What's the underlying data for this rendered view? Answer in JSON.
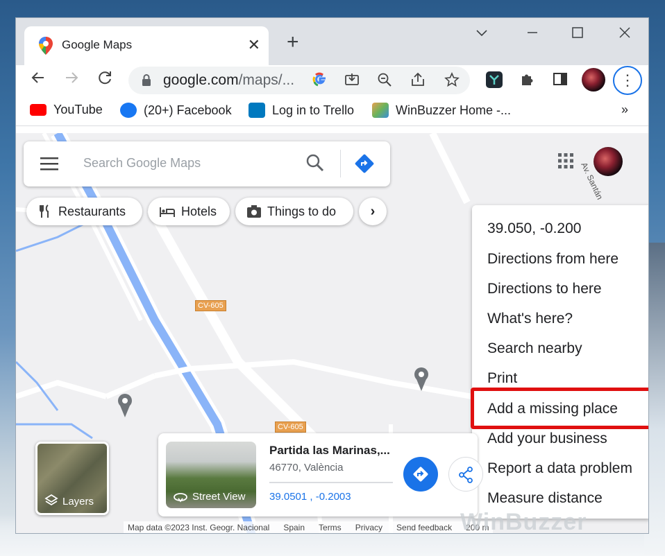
{
  "browser": {
    "tab": {
      "title": "Google Maps"
    },
    "omnibox": {
      "url_domain": "google.com",
      "url_rest": "/maps/..."
    },
    "bookmarks": [
      {
        "label": "YouTube",
        "icon": "youtube-icon"
      },
      {
        "label": "(20+) Facebook",
        "icon": "facebook-icon"
      },
      {
        "label": "Log in to Trello",
        "icon": "trello-icon"
      },
      {
        "label": "WinBuzzer Home -...",
        "icon": "winbuzzer-icon"
      }
    ],
    "more_bookmarks": "»"
  },
  "maps": {
    "search_placeholder": "Search Google Maps",
    "chips": [
      "Restaurants",
      "Hotels",
      "Things to do"
    ],
    "road_labels": [
      "CV-605",
      "CV-605"
    ],
    "street_label": "Av. Santán",
    "context_menu": {
      "coords": "39.050, -0.200",
      "items": [
        "Directions from here",
        "Directions to here",
        "What's here?",
        "Search nearby",
        "Print",
        "Add a missing place",
        "Add your business",
        "Report a data problem",
        "Measure distance"
      ]
    },
    "layers_label": "Layers",
    "place_card": {
      "title": "Partida las Marinas,...",
      "address": "46770, València",
      "coords": "39.0501 , -0.2003",
      "street_view_label": "Street View"
    },
    "footer": {
      "map_data": "Map data ©2023 Inst. Geogr. Nacional",
      "links": [
        "Spain",
        "Terms",
        "Privacy",
        "Send feedback"
      ],
      "scale": "200 m"
    }
  },
  "watermark": "WinBuzzer",
  "colors": {
    "accent": "#1a73e8",
    "highlight": "#e01010",
    "road_label": "#e8a050"
  }
}
